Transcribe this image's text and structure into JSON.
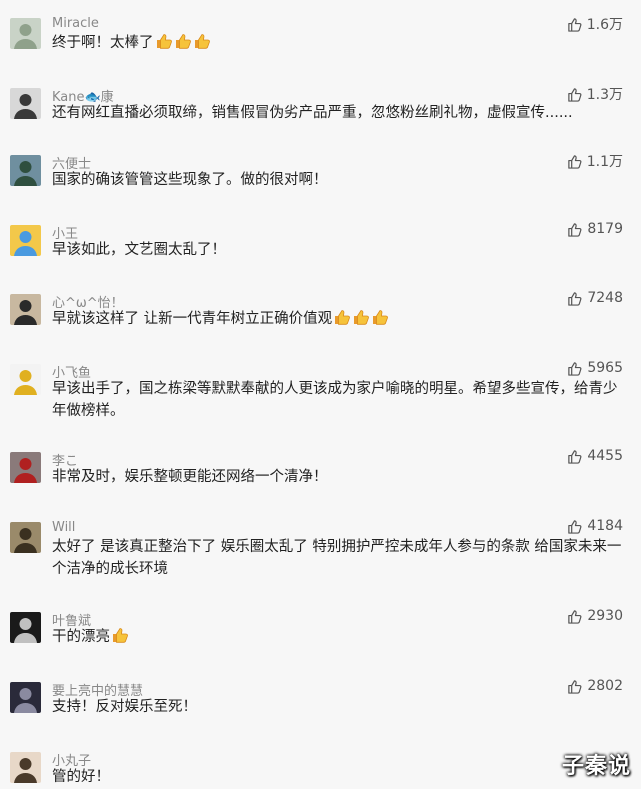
{
  "comments": [
    {
      "user": "Miracle",
      "likes": "1.6万",
      "text": "终于啊！太棒了",
      "thumbs": 3,
      "avatar_color": "#c9d3c7",
      "avatar_accent": "#8fa18b"
    },
    {
      "user": "Kane🐟康",
      "likes": "1.3万",
      "text": "还有网红直播必须取缔，销售假冒伪劣产品严重，忽悠粉丝刷礼物，虚假宣传......",
      "thumbs": 0,
      "avatar_color": "#d8d8d8",
      "avatar_accent": "#3a3a3a"
    },
    {
      "user": "六便士",
      "likes": "1.1万",
      "text": "国家的确该管管这些现象了。做的很对啊！",
      "thumbs": 0,
      "avatar_color": "#6f8f9f",
      "avatar_accent": "#2f4f3f"
    },
    {
      "user": "小王",
      "likes": "8179",
      "text": "早该如此，文艺圈太乱了！",
      "thumbs": 0,
      "avatar_color": "#f3c84a",
      "avatar_accent": "#4a9ae0"
    },
    {
      "user": "心^ω^怡！",
      "likes": "7248",
      "text": "早就该这样了  让新一代青年树立正确价值观",
      "thumbs": 3,
      "avatar_color": "#c8b8a0",
      "avatar_accent": "#2a2a2a"
    },
    {
      "user": "小飞鱼",
      "likes": "5965",
      "text": "早该出手了，国之栋梁等默默奉献的人更该成为家户喻晓的明星。希望多些宣传，给青少年做榜样。",
      "thumbs": 0,
      "avatar_color": "#f3f3f3",
      "avatar_accent": "#e0b020"
    },
    {
      "user": "李こ",
      "likes": "4455",
      "text": "非常及时，娱乐整顿更能还网络一个清净！",
      "thumbs": 0,
      "avatar_color": "#8a7a7a",
      "avatar_accent": "#b02020"
    },
    {
      "user": "Will",
      "likes": "4184",
      "text": "太好了  是该真正整治下了  娱乐圈太乱了  特别拥护严控未成年人参与的条款  给国家未来一个洁净的成长环境",
      "thumbs": 0,
      "avatar_color": "#9a8a6a",
      "avatar_accent": "#3a3020"
    },
    {
      "user": "叶鲁斌",
      "likes": "2930",
      "text": "干的漂亮",
      "thumbs": 1,
      "avatar_color": "#1a1a1a",
      "avatar_accent": "#c0c0c0"
    },
    {
      "user": "要上亮中的慧慧",
      "likes": "2802",
      "text": "支持！反对娱乐至死！",
      "thumbs": 0,
      "avatar_color": "#2a2a3a",
      "avatar_accent": "#8a8aa0"
    },
    {
      "user": "小丸子",
      "likes": "",
      "text": "管的好！",
      "thumbs": 0,
      "avatar_color": "#e8d8c8",
      "avatar_accent": "#4a3a2a"
    }
  ],
  "watermark": "子秦说",
  "icons": {
    "like": "thumbs-up-outline-icon",
    "emoji": "thumbs-up-emoji-icon"
  },
  "colors": {
    "background": "#f7f7f7",
    "username": "#888888",
    "text": "#222222",
    "likes": "#555555"
  }
}
